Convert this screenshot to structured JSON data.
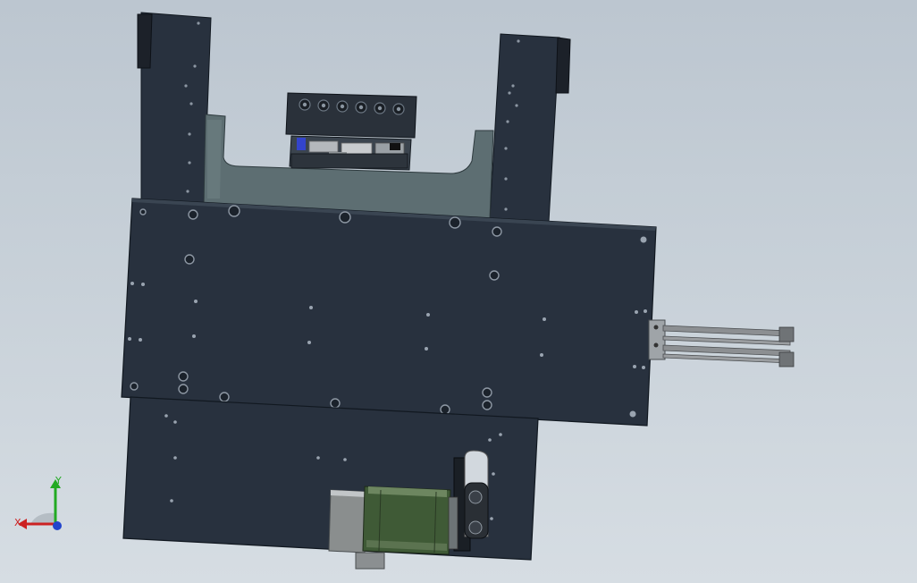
{
  "viewport": {
    "background_top": "#bcc6d0",
    "background_bottom": "#d6dde3"
  },
  "colors": {
    "plate": "#28313e",
    "plate_edge": "#111820",
    "plate_top_face": "#3a4552",
    "bracket": "#5a6a70",
    "motor_body": "#8a8e8e",
    "motor_green": "#3f5a36",
    "rod": "#8c8f92",
    "axis_x": "#cc2222",
    "axis_y": "#22aa22",
    "axis_z": "#2244cc"
  },
  "triad": {
    "x_label": "X",
    "y_label": "Y"
  },
  "icons": {
    "orientation": "coordinate-triad-icon"
  }
}
